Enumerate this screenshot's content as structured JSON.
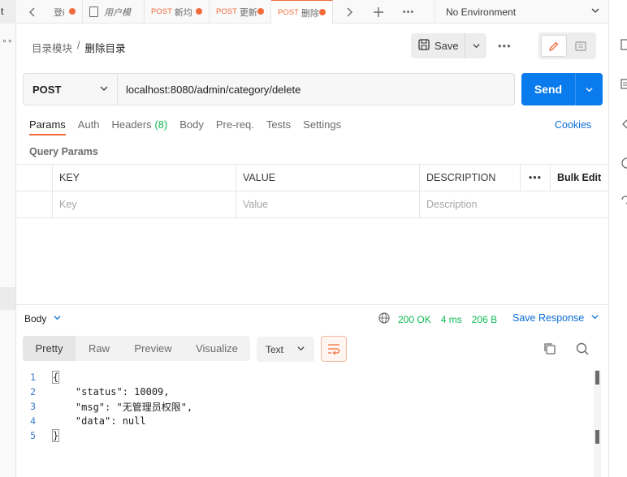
{
  "left_panel": {
    "tab_fragment": "t",
    "more": "∘∘"
  },
  "tabs": [
    {
      "method": "",
      "name": "登i",
      "italic": false,
      "unsaved": true
    },
    {
      "method": "",
      "name": "用户模",
      "italic": true,
      "unsaved": false,
      "icon": "document-icon"
    },
    {
      "method": "POST",
      "name": "新均",
      "italic": false,
      "unsaved": true
    },
    {
      "method": "POST",
      "name": "更新",
      "italic": false,
      "unsaved": true
    },
    {
      "method": "POST",
      "name": "删除",
      "italic": false,
      "unsaved": true,
      "active": true
    }
  ],
  "environment": {
    "label": "No Environment"
  },
  "breadcrumb": {
    "parent": "目录模块",
    "separator": "/",
    "current": "删除目录"
  },
  "toolbar": {
    "save_label": "Save",
    "more": "•••"
  },
  "request": {
    "method": "POST",
    "url": "localhost:8080/admin/category/delete",
    "send_label": "Send"
  },
  "request_tabs": [
    {
      "label": "Params",
      "active": true
    },
    {
      "label": "Auth"
    },
    {
      "label": "Headers",
      "count": "(8)"
    },
    {
      "label": "Body"
    },
    {
      "label": "Pre-req."
    },
    {
      "label": "Tests"
    },
    {
      "label": "Settings"
    }
  ],
  "cookies_label": "Cookies",
  "query_params": {
    "title": "Query Params",
    "headers": {
      "key": "KEY",
      "value": "VALUE",
      "description": "DESCRIPTION",
      "more": "•••",
      "bulk_edit": "Bulk Edit"
    },
    "placeholders": {
      "key": "Key",
      "value": "Value",
      "description": "Description"
    }
  },
  "response": {
    "body_label": "Body",
    "status": "200 OK",
    "time": "4 ms",
    "size": "206 B",
    "save_label": "Save Response",
    "format_tabs": [
      "Pretty",
      "Raw",
      "Preview",
      "Visualize"
    ],
    "active_format": "Pretty",
    "type_select": "Text",
    "lines": [
      {
        "n": "1",
        "text": "{"
      },
      {
        "n": "2",
        "text": "    \"status\": 10009,"
      },
      {
        "n": "3",
        "text": "    \"msg\": \"无管理员权限\","
      },
      {
        "n": "4",
        "text": "    \"data\": null"
      },
      {
        "n": "5",
        "text": "}"
      }
    ]
  },
  "colors": {
    "accent": "#f26b3a",
    "primary": "#097bed",
    "success": "#0cbb52",
    "link": "#0b6dd6"
  }
}
